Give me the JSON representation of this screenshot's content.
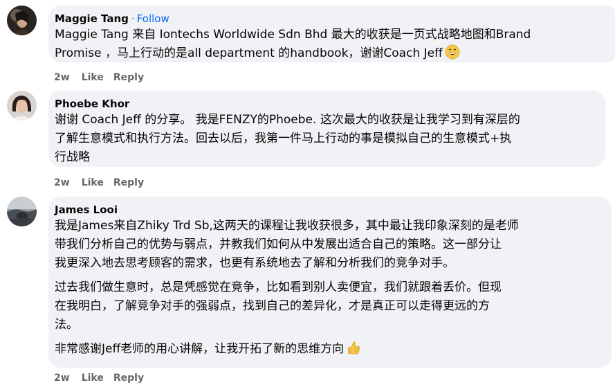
{
  "comments": [
    {
      "author": "Maggie Tang",
      "follow_label": "Follow",
      "separator": "·",
      "lines": [
        "Maggie Tang 来自 Iontechs Worldwide Sdn Bhd 最大的收获是一页式战略地图和Brand",
        "Promise ，马上行动的是all department 的handbook，谢谢Coach Jeff"
      ],
      "emoji": "grinning-face-emoji",
      "time": "2w",
      "like_label": "Like",
      "reply_label": "Reply"
    },
    {
      "author": "Phoebe Khor",
      "lines": [
        "谢谢 Coach Jeff 的分享。 我是FENZY的Phoebe. 这次最大的收获是让我学习到有深层的",
        "了解生意模式和执行方法。回去以后，我第一件马上行动的事是模拟自己的生意模式+执",
        "行战略"
      ],
      "time": "2w",
      "like_label": "Like",
      "reply_label": "Reply"
    },
    {
      "author": "James Looi",
      "paragraphs": [
        [
          "我是James来自Zhiky Trd Sb,这两天的课程让我收获很多，其中最让我印象深刻的是老师",
          "带我们分析自己的优势与弱点，并教我们如何从中发展出适合自己的策略。这一部分让",
          "我更深入地去思考顾客的需求，也更有系统地去了解和分析我们的竞争对手。"
        ],
        [
          "过去我们做生意时，总是凭感觉在竞争，比如看到别人卖便宜，我们就跟着丢价。但现",
          "在我明白，了解竞争对手的强弱点，找到自己的差异化，才是真正可以走得更远的方",
          "法。"
        ],
        [
          "非常感谢Jeff老师的用心讲解，让我开拓了新的思维方向"
        ]
      ],
      "emoji": "thumbs-up-emoji",
      "time": "2w",
      "like_label": "Like",
      "reply_label": "Reply"
    }
  ]
}
